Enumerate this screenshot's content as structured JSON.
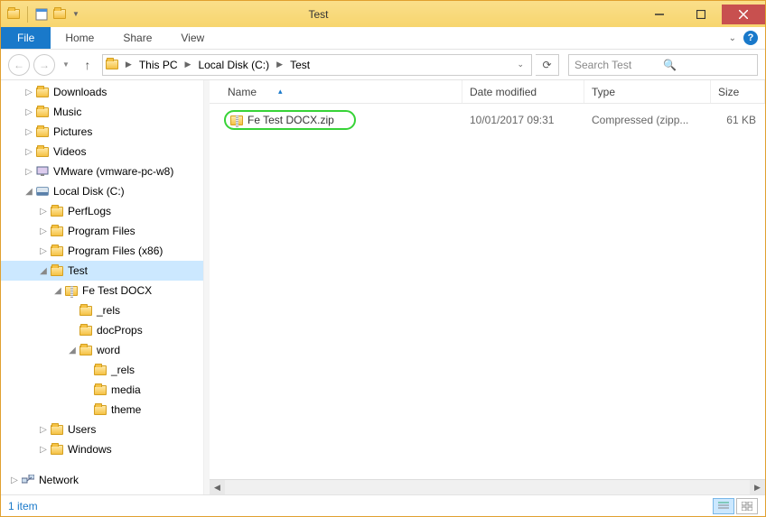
{
  "window": {
    "title": "Test"
  },
  "ribbon": {
    "file": "File",
    "tabs": [
      "Home",
      "Share",
      "View"
    ]
  },
  "breadcrumbs": [
    "This PC",
    "Local Disk (C:)",
    "Test"
  ],
  "search": {
    "placeholder": "Search Test"
  },
  "columns": {
    "name": "Name",
    "date": "Date modified",
    "type": "Type",
    "size": "Size"
  },
  "files": [
    {
      "name": "Fe Test DOCX.zip",
      "date": "10/01/2017 09:31",
      "type": "Compressed (zipp...",
      "size": "61 KB"
    }
  ],
  "tree": {
    "downloads": "Downloads",
    "music": "Music",
    "pictures": "Pictures",
    "videos": "Videos",
    "vmware": "VMware (vmware-pc-w8)",
    "localdisk": "Local Disk (C:)",
    "perflogs": "PerfLogs",
    "programfiles": "Program Files",
    "programfilesx86": "Program Files (x86)",
    "test": "Test",
    "fetestdocx": "Fe Test DOCX",
    "rels": "_rels",
    "docprops": "docProps",
    "word": "word",
    "rels2": "_rels",
    "media": "media",
    "theme": "theme",
    "users": "Users",
    "windows": "Windows",
    "network": "Network"
  },
  "status": {
    "text": "1 item"
  }
}
